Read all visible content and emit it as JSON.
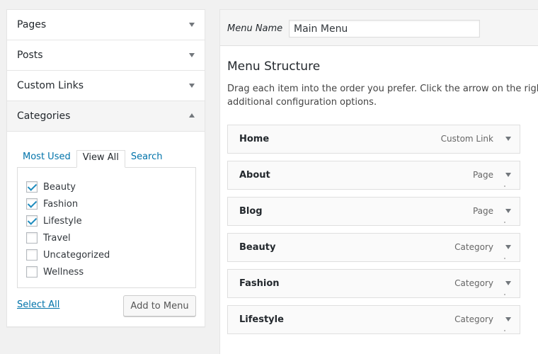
{
  "accordion": {
    "sections": [
      {
        "label": "Pages"
      },
      {
        "label": "Posts"
      },
      {
        "label": "Custom Links"
      },
      {
        "label": "Categories"
      }
    ],
    "tabs": [
      "Most Used",
      "View All",
      "Search"
    ],
    "active_tab": "View All",
    "categories": [
      {
        "label": "Beauty",
        "checked": true
      },
      {
        "label": "Fashion",
        "checked": true
      },
      {
        "label": "Lifestyle",
        "checked": true
      },
      {
        "label": "Travel",
        "checked": false
      },
      {
        "label": "Uncategorized",
        "checked": false
      },
      {
        "label": "Wellness",
        "checked": false
      }
    ],
    "select_all": "Select All",
    "add_button": "Add to Menu"
  },
  "menu": {
    "name_label": "Menu Name",
    "name_value": "Main Menu",
    "structure_title": "Menu Structure",
    "structure_desc_line1": "Drag each item into the order you prefer. Click the arrow on the right",
    "structure_desc_line2": "additional configuration options.",
    "items": [
      {
        "title": "Home",
        "type": "Custom Link"
      },
      {
        "title": "About",
        "type": "Page"
      },
      {
        "title": "Blog",
        "type": "Page"
      },
      {
        "title": "Beauty",
        "type": "Category"
      },
      {
        "title": "Fashion",
        "type": "Category"
      },
      {
        "title": "Lifestyle",
        "type": "Category"
      }
    ]
  }
}
